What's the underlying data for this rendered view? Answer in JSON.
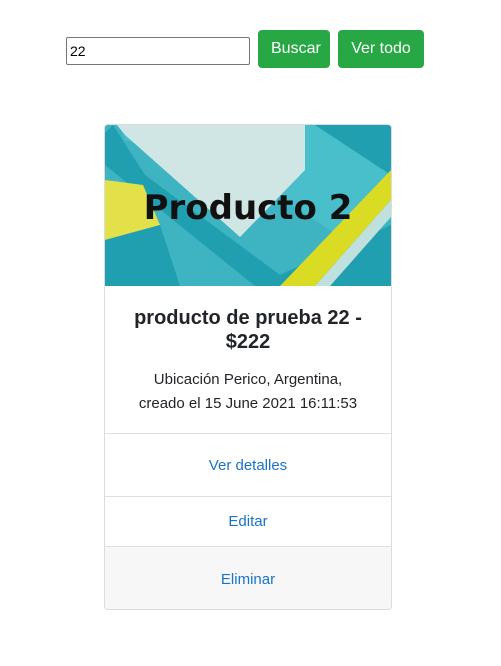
{
  "search": {
    "value": "22",
    "button_label": "Buscar",
    "view_all_label": "Ver todo"
  },
  "card": {
    "image_text": "Producto 2",
    "title": "producto de prueba 22 - $222",
    "location": "Ubicación Perico, Argentina,",
    "created": "creado el 15 June 2021 16:11:53",
    "details_label": "Ver detalles",
    "edit_label": "Editar",
    "delete_label": "Eliminar"
  },
  "colors": {
    "success_button": "#28a745",
    "link": "#1a73c8",
    "image_teal": "#1f9fb0",
    "image_light": "#cfe6e4",
    "image_cyan": "#48bfcb",
    "image_yellow": "#d9dc23"
  }
}
